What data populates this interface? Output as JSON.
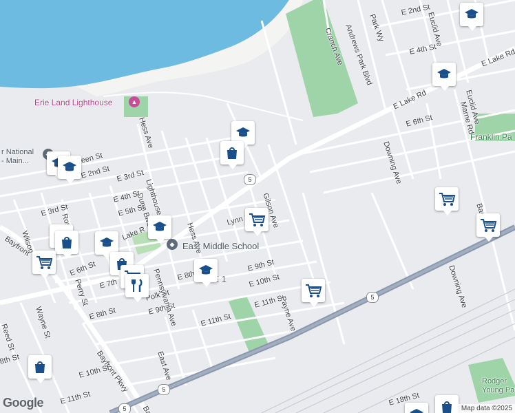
{
  "map": {
    "colors": {
      "water": "#6dbbe0",
      "park": "#9ed4a8",
      "highway": "#8a97ad",
      "road": "#ffffff",
      "land": "#e9ebef",
      "school": "#1a4f8a"
    },
    "highway_shield": "5",
    "zone_fragment": "NE 1",
    "pois": {
      "lighthouse": "Erie Land Lighthouse",
      "middle_school": "East Middle School",
      "national": "r National\n- Main...",
      "franklin": "Franklin Pa"
    },
    "streets": {
      "hess_ave_north": "Hess Ave",
      "cranch_ave": "Cranch Ave",
      "andrews_park": "Andrews Park Blvd",
      "park_wy": "Park Wy",
      "e_2nd_st_ne": "E 2nd St",
      "euclid_ave_top": "Euclid Ave",
      "e_4th_st_ne": "E 4th St",
      "e_lake_rd_ne": "E Lake Rd",
      "euclid_ave": "Euclid Ave",
      "marne_rd": "Marne Rd",
      "e_lake_rd": "E Lake Rd",
      "downing_ave_n": "Downing Ave",
      "e_6th_st_e": "E 6th St",
      "gilson_ave": "Gilson Ave",
      "lighthouse_st": "Lighthouse St",
      "dunn_blvd": "Dunn Blvd",
      "hess_ave": "Hess Ave",
      "lynn_st": "Lynn St",
      "e_3rd_st": "E 3rd St",
      "e_4th_st": "E 4th St",
      "e_5th_st": "E 5th St",
      "e_2nd_st": "E 2nd St",
      "green_st": "een St",
      "e_3rd_st_w": "E 3rd St",
      "ross_st": "Ross St",
      "wilson": "Wilson",
      "bayfront": "Bayfront",
      "lake_r": "Lake R",
      "e_6th_st": "E 6th St",
      "perry_st": "Perry St",
      "e_7th": "E 7th",
      "e_8th_st": "E 8th St",
      "e_8th": "E 8th",
      "polk_st": "Polk St",
      "e_9th_st_w": "E 9th St",
      "pennsylvania": "Pennsylvania Ave",
      "e_9th_st": "E 9th St",
      "e_10th_st": "E 10th St",
      "e_11th_st_c": "E 11th St",
      "payne_ave": "Payne Ave",
      "e_11th_st": "E 11th St",
      "wayne_st": "Wayne St",
      "reed_st": "Reed St",
      "8th_st": "8th St",
      "bayfront_pkwy": "Bayfront Pkwy",
      "e_10th_st_sw": "E 10th St",
      "east_ave": "East Ave",
      "e_11th_st_sw": "E 11th St",
      "bay_s": "Bay",
      "downing_ave_s": "Downing Ave",
      "bac": "Bac",
      "e_18th_st": "E 18th St",
      "rodger": "Rodger\nYoung Par"
    }
  },
  "footer": {
    "google": "Google",
    "attribution": "Map data ©2025"
  }
}
